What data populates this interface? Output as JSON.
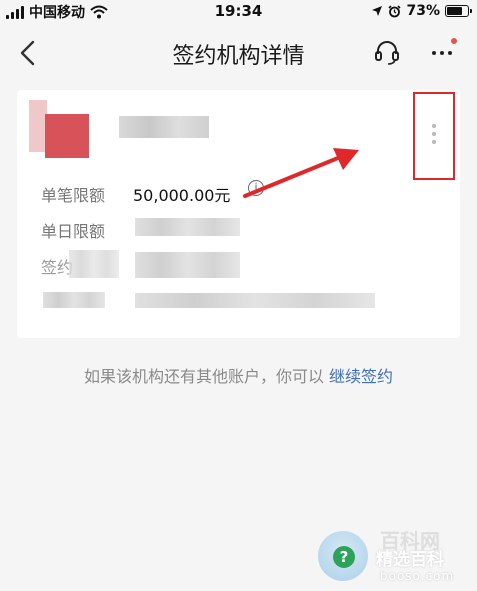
{
  "status_bar": {
    "carrier": "中国移动",
    "time": "19:34",
    "battery_percent": "73%",
    "battery_level": 0.73
  },
  "nav": {
    "title": "签约机构详情"
  },
  "card": {
    "single_limit_label": "单笔限额",
    "single_limit_value": "50,000.00元",
    "daily_limit_label": "单日限额",
    "sign_label_partial": "签约"
  },
  "hint": {
    "text": "如果该机构还有其他账户，你可以 ",
    "link": "继续签约"
  },
  "watermark": {
    "faint": "百科网",
    "title": "精选百科",
    "domain": "booso.com"
  },
  "colors": {
    "annotation_red": "#e0282a",
    "link_blue": "#3f6fb8",
    "logo_red": "#d8525a"
  }
}
